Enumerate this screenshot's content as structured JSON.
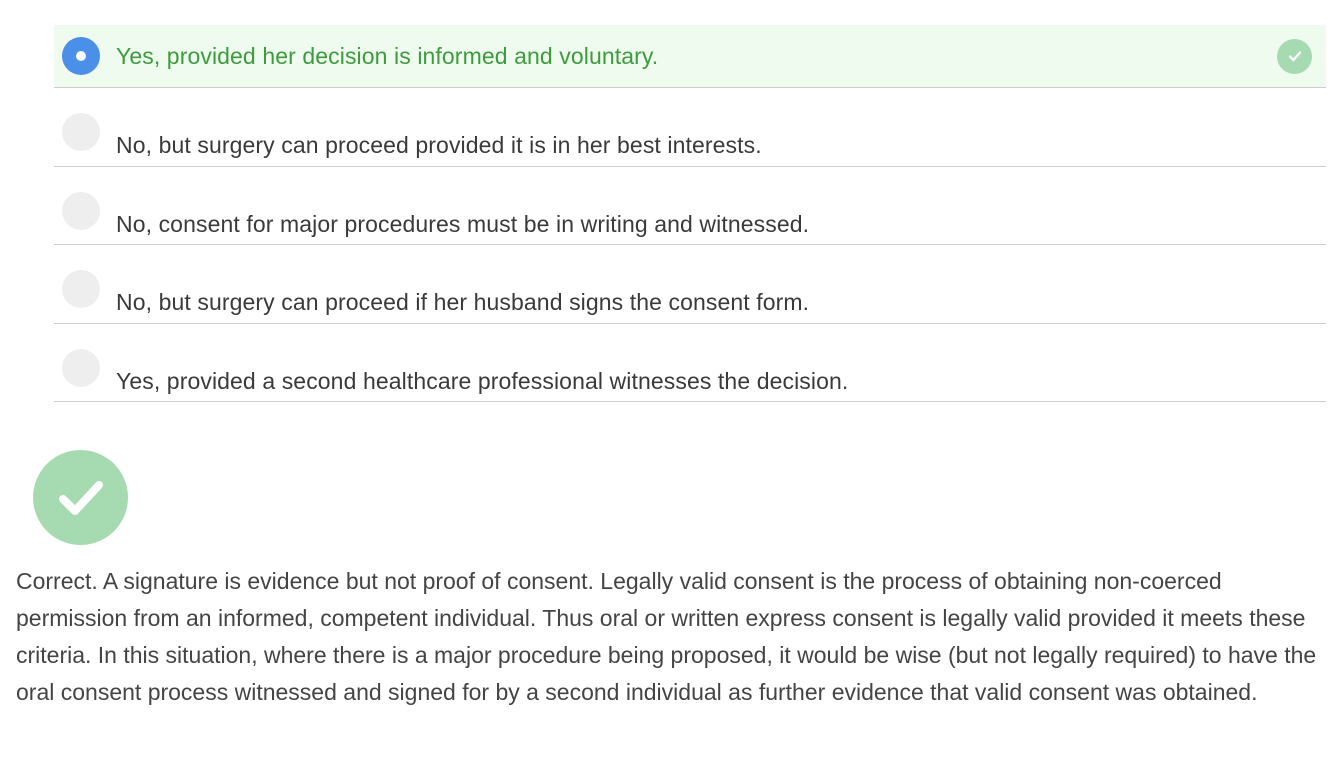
{
  "question": {
    "options": [
      {
        "label": "Yes, provided her decision is informed and voluntary.",
        "selected": true,
        "correct": true
      },
      {
        "label": "No, but surgery can proceed provided it is in her best interests.",
        "selected": false
      },
      {
        "label": "No, consent for major procedures must be in writing and witnessed.",
        "selected": false
      },
      {
        "label": "No, but surgery can proceed if her husband signs the consent form.",
        "selected": false
      },
      {
        "label": "Yes, provided a second healthcare professional witnesses the decision.",
        "selected": false
      }
    ]
  },
  "feedback": {
    "icon": "check-circle-icon",
    "text": "Correct. A signature is evidence but not proof of consent. Legally valid consent is the process of obtaining non-coerced permission from an informed, competent individual. Thus oral or written express consent is legally valid provided it meets these criteria. In this situation, where there is a major procedure being proposed, it would be wise (but not legally required) to have the oral consent process witnessed and signed for by a second individual as further evidence that valid consent was obtained."
  },
  "colors": {
    "selected_bg": "#eefbee",
    "selected_text": "#3e9b3e",
    "radio_selected": "#4a8fe8",
    "check_green": "#a6dab1"
  }
}
